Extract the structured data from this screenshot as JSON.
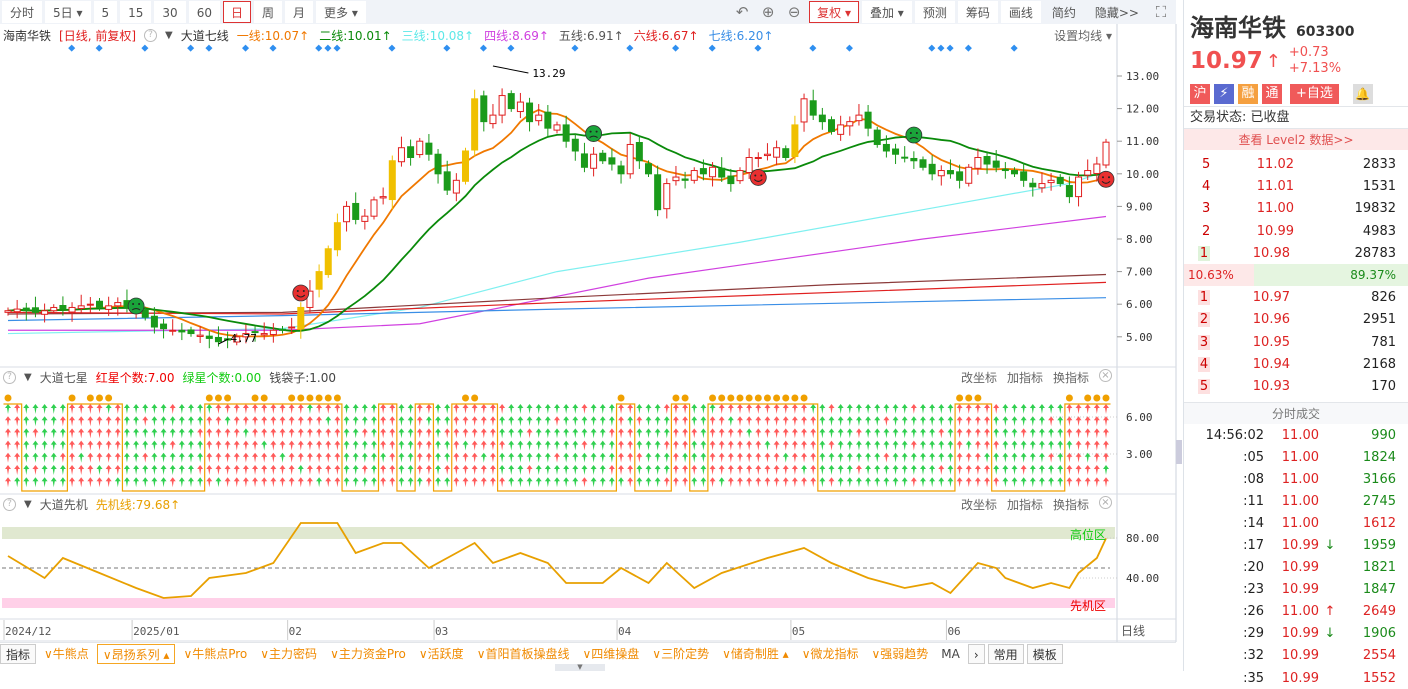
{
  "toolbar": {
    "items": [
      "分时",
      "5日 ▾",
      "5",
      "15",
      "30",
      "60",
      "日",
      "周",
      "月",
      "更多 ▾"
    ],
    "active": "日",
    "right": [
      "复权 ▾",
      "叠加 ▾",
      "预测",
      "筹码",
      "画线",
      "简约",
      "隐藏>>"
    ]
  },
  "legend": {
    "name": "海南华铁",
    "mode": "[日线, 前复权]",
    "indicator": "大道七线",
    "settings": "设置均线 ▾",
    "lines": [
      {
        "label": "一线:10.07↑",
        "color": "#f07800"
      },
      {
        "label": "二线:10.01↑",
        "color": "#0a8a0a"
      },
      {
        "label": "三线:10.08↑",
        "color": "#5de8e8"
      },
      {
        "label": "四线:8.69↑",
        "color": "#d040e0"
      },
      {
        "label": "五线:6.91↑",
        "color": "#555555"
      },
      {
        "label": "六线:6.67↑",
        "color": "#e02020"
      },
      {
        "label": "七线:6.20↑",
        "color": "#3a8ee6"
      }
    ]
  },
  "panel2": {
    "name": "大道七星",
    "red": "红星个数:7.00",
    "green": "绿星个数:0.00",
    "bag": "钱袋子:1.00",
    "btns": [
      "改坐标",
      "加指标",
      "换指标"
    ]
  },
  "panel3": {
    "name": "大道先机",
    "line": "先机线:79.68↑",
    "btns": [
      "改坐标",
      "加指标",
      "换指标"
    ],
    "high_zone": "高位区",
    "low_zone": "先机区"
  },
  "chart_data": {
    "type": "candlestick",
    "y_ticks": [
      "13.00",
      "12.00",
      "11.00",
      "10.00",
      "9.00",
      "8.00",
      "7.00",
      "6.00",
      "5.00"
    ],
    "high_label": "13.29",
    "low_label": "4.77",
    "closes": [
      5.8,
      5.85,
      5.8,
      5.75,
      5.8,
      5.9,
      5.85,
      5.9,
      5.95,
      6.0,
      5.9,
      5.95,
      6.05,
      5.9,
      5.85,
      5.6,
      5.3,
      5.25,
      5.2,
      5.15,
      5.1,
      5.05,
      4.95,
      4.85,
      4.9,
      5.0,
      5.1,
      5.15,
      5.1,
      5.2,
      5.2,
      5.3,
      5.9,
      6.4,
      7.0,
      7.7,
      8.5,
      9.0,
      8.6,
      8.7,
      9.2,
      9.3,
      10.4,
      10.8,
      10.5,
      11.0,
      10.6,
      10.0,
      9.5,
      9.8,
      10.7,
      12.3,
      11.6,
      11.8,
      12.4,
      12.0,
      12.2,
      11.6,
      11.8,
      11.4,
      11.5,
      11.0,
      10.7,
      10.2,
      10.6,
      10.4,
      10.3,
      10.0,
      10.9,
      10.4,
      10.0,
      8.9,
      9.7,
      9.9,
      9.8,
      10.1,
      10.0,
      10.2,
      9.9,
      9.7,
      10.1,
      10.5,
      10.5,
      10.6,
      10.8,
      10.5,
      11.5,
      12.3,
      11.8,
      11.6,
      11.3,
      11.5,
      11.6,
      11.8,
      11.4,
      10.9,
      10.7,
      10.6,
      10.5,
      10.4,
      10.2,
      10.0,
      10.1,
      10.0,
      9.8,
      10.2,
      10.5,
      10.3,
      10.2,
      10.1,
      10.0,
      9.8,
      9.6,
      9.7,
      9.8,
      9.7,
      9.3,
      9.9,
      10.1,
      10.3,
      10.97
    ],
    "ma_keypoints": {
      "三线": [
        [
          0,
          5.1
        ],
        [
          30,
          5.25
        ],
        [
          45,
          5.9
        ],
        [
          60,
          7.0
        ],
        [
          80,
          7.9
        ],
        [
          100,
          8.9
        ],
        [
          116,
          9.7
        ],
        [
          120,
          10.08
        ]
      ],
      "四线": [
        [
          0,
          5.2
        ],
        [
          30,
          5.2
        ],
        [
          45,
          5.4
        ],
        [
          70,
          6.8
        ],
        [
          100,
          8.0
        ],
        [
          120,
          8.69
        ]
      ],
      "五线": [
        [
          0,
          5.7
        ],
        [
          30,
          5.75
        ],
        [
          60,
          6.2
        ],
        [
          90,
          6.6
        ],
        [
          120,
          6.91
        ]
      ],
      "六线": [
        [
          0,
          5.75
        ],
        [
          30,
          5.7
        ],
        [
          60,
          6.05
        ],
        [
          120,
          6.67
        ]
      ],
      "七线": [
        [
          0,
          5.5
        ],
        [
          30,
          5.65
        ],
        [
          60,
          5.85
        ],
        [
          120,
          6.2
        ]
      ]
    },
    "signals": [
      {
        "i": 14,
        "type": "green"
      },
      {
        "i": 32,
        "type": "red"
      },
      {
        "i": 64,
        "type": "green"
      },
      {
        "i": 82,
        "type": "red"
      },
      {
        "i": 99,
        "type": "green"
      },
      {
        "i": 120,
        "type": "red"
      }
    ],
    "diamonds": [
      7,
      10,
      15,
      20,
      22,
      26,
      29,
      34,
      35,
      36,
      42,
      48,
      52,
      55,
      62,
      68,
      73,
      77,
      82,
      88,
      92,
      101,
      102,
      103,
      105,
      110
    ],
    "x_labels": [
      {
        "i": 0,
        "t": "2024/12"
      },
      {
        "i": 14,
        "t": "2025/01"
      },
      {
        "i": 31,
        "t": "02"
      },
      {
        "i": 47,
        "t": "03"
      },
      {
        "i": 67,
        "t": "04"
      },
      {
        "i": 86,
        "t": "05"
      },
      {
        "i": 103,
        "t": "06"
      }
    ],
    "period": "日线",
    "star_high_ranges": [
      [
        0,
        1
      ],
      [
        7,
        8
      ],
      [
        9,
        12
      ],
      [
        22,
        36
      ],
      [
        41,
        42
      ],
      [
        45,
        46
      ],
      [
        49,
        53
      ],
      [
        67,
        68
      ],
      [
        73,
        74
      ],
      [
        77,
        88
      ],
      [
        104,
        107
      ],
      [
        116,
        120
      ]
    ],
    "star_ticks": [
      "6.00",
      "3.00"
    ],
    "xianji": {
      "ticks": [
        "80.00",
        "40.00"
      ],
      "points": [
        [
          0,
          62
        ],
        [
          4,
          40
        ],
        [
          6,
          60
        ],
        [
          10,
          45
        ],
        [
          14,
          30
        ],
        [
          17,
          20
        ],
        [
          20,
          22
        ],
        [
          22,
          40
        ],
        [
          26,
          45
        ],
        [
          29,
          55
        ],
        [
          32,
          95
        ],
        [
          36,
          95
        ],
        [
          38,
          65
        ],
        [
          41,
          75
        ],
        [
          43,
          75
        ],
        [
          46,
          50
        ],
        [
          49,
          65
        ],
        [
          51,
          75
        ],
        [
          53,
          55
        ],
        [
          56,
          65
        ],
        [
          59,
          55
        ],
        [
          61,
          35
        ],
        [
          65,
          35
        ],
        [
          67,
          50
        ],
        [
          70,
          35
        ],
        [
          72,
          55
        ],
        [
          75,
          30
        ],
        [
          78,
          45
        ],
        [
          83,
          60
        ],
        [
          87,
          70
        ],
        [
          90,
          55
        ],
        [
          94,
          40
        ],
        [
          98,
          30
        ],
        [
          101,
          35
        ],
        [
          103,
          25
        ],
        [
          106,
          55
        ],
        [
          108,
          50
        ],
        [
          109,
          40
        ],
        [
          112,
          30
        ],
        [
          114,
          35
        ],
        [
          116,
          30
        ],
        [
          117,
          45
        ],
        [
          119,
          60
        ],
        [
          120,
          79.68
        ]
      ]
    }
  },
  "bottom": {
    "items": [
      "指标",
      "∨牛熊点",
      "∨昂扬系列 ▴",
      "∨牛熊点Pro",
      "∨主力密码",
      "∨主力资金Pro",
      "∨活跃度",
      "∨首阳首板操盘线",
      "∨四维操盘",
      "∨三阶定势",
      "∨储奇制胜 ▴",
      "∨微龙指标",
      "∨强弱趋势",
      "MA"
    ],
    "common": "常用",
    "template": "模板"
  },
  "stock": {
    "name": "海南华铁",
    "code": "603300",
    "price": "10.97",
    "arrow": "↑",
    "change": "+0.73",
    "pct": "+7.13%",
    "tags": [
      "沪",
      "⚡",
      "融",
      "通"
    ],
    "watch": "+自选",
    "status": "交易状态: 已收盘",
    "level2": "查看 Level2 数据>>"
  },
  "sell": [
    {
      "n": "5",
      "p": "11.02",
      "v": "2833"
    },
    {
      "n": "4",
      "p": "11.01",
      "v": "1531"
    },
    {
      "n": "3",
      "p": "11.00",
      "v": "19832"
    },
    {
      "n": "2",
      "p": "10.99",
      "v": "4983"
    },
    {
      "n": "1",
      "p": "10.98",
      "v": "28783"
    }
  ],
  "ratio": {
    "buy": "10.63%",
    "sell": "89.37%"
  },
  "buy": [
    {
      "n": "1",
      "p": "10.97",
      "v": "826"
    },
    {
      "n": "2",
      "p": "10.96",
      "v": "2951"
    },
    {
      "n": "3",
      "p": "10.95",
      "v": "781"
    },
    {
      "n": "4",
      "p": "10.94",
      "v": "2168"
    },
    {
      "n": "5",
      "p": "10.93",
      "v": "170"
    }
  ],
  "trades_title": "分时成交",
  "trades": [
    {
      "t": "14:56:02",
      "p": "11.00",
      "a": "",
      "v": "990",
      "c": "#1a8a1a"
    },
    {
      "t": ":05",
      "p": "11.00",
      "a": "",
      "v": "1824",
      "c": "#1a8a1a"
    },
    {
      "t": ":08",
      "p": "11.00",
      "a": "",
      "v": "3166",
      "c": "#1a8a1a"
    },
    {
      "t": ":11",
      "p": "11.00",
      "a": "",
      "v": "2745",
      "c": "#1a8a1a"
    },
    {
      "t": ":14",
      "p": "11.00",
      "a": "",
      "v": "1612",
      "c": "#d22"
    },
    {
      "t": ":17",
      "p": "10.99",
      "a": "↓",
      "v": "1959",
      "c": "#1a8a1a"
    },
    {
      "t": ":20",
      "p": "10.99",
      "a": "",
      "v": "1821",
      "c": "#1a8a1a"
    },
    {
      "t": ":23",
      "p": "10.99",
      "a": "",
      "v": "1847",
      "c": "#1a8a1a"
    },
    {
      "t": ":26",
      "p": "11.00",
      "a": "↑",
      "v": "2649",
      "c": "#d22"
    },
    {
      "t": ":29",
      "p": "10.99",
      "a": "↓",
      "v": "1906",
      "c": "#1a8a1a"
    },
    {
      "t": ":32",
      "p": "10.99",
      "a": "",
      "v": "2554",
      "c": "#d22"
    },
    {
      "t": ":35",
      "p": "10.99",
      "a": "",
      "v": "1552",
      "c": "#d22"
    }
  ]
}
